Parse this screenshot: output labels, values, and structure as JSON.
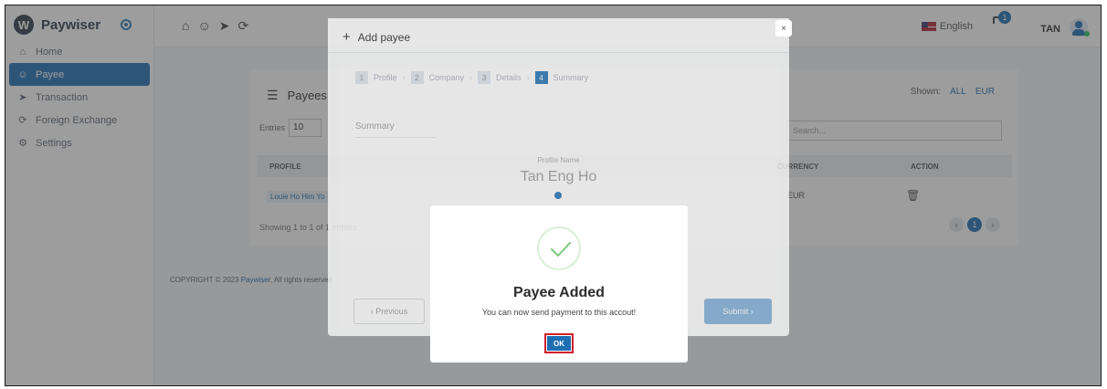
{
  "sidebar": {
    "brand": "Paywiser",
    "logo_letter": "W",
    "items": [
      {
        "label": "Home",
        "icon": "home-icon",
        "glyph": "⌂"
      },
      {
        "label": "Payee",
        "icon": "users-icon",
        "glyph": "☺"
      },
      {
        "label": "Transaction",
        "icon": "send-icon",
        "glyph": "➤"
      },
      {
        "label": "Foreign Exchange",
        "icon": "exchange-icon",
        "glyph": "⟳"
      },
      {
        "label": "Settings",
        "icon": "gear-icon",
        "glyph": "⚙"
      }
    ],
    "active_index": 1
  },
  "header": {
    "language": "English",
    "notification_count": "1",
    "user_name": "TAN"
  },
  "payees_card": {
    "title": "Payees",
    "shown_label": "Shown:",
    "shown_options": [
      "ALL",
      "EUR"
    ],
    "entries_label": "Entries",
    "entries_value": "10",
    "search_placeholder": "Search...",
    "columns": {
      "profile": "PROFILE",
      "currency": "CURRENCY",
      "action": "ACTION"
    },
    "row": {
      "profile": "Louie Ho Him Yo",
      "currency": "EUR"
    },
    "showing": "Showing 1 to 1 of 1 entries",
    "page": "1",
    "prev": "‹",
    "next": "›"
  },
  "footer": {
    "copyright_prefix": "COPYRIGHT © 2023",
    "brand": "Paywiser",
    "suffix": ", All rights reserved"
  },
  "add_payee": {
    "title": "Add payee",
    "steps": [
      {
        "num": "1",
        "label": "Profile"
      },
      {
        "num": "2",
        "label": "Company"
      },
      {
        "num": "3",
        "label": "Details"
      },
      {
        "num": "4",
        "label": "Summary"
      }
    ],
    "summary_label": "Summary",
    "profile_name_label": "Profile Name",
    "profile_name_value": "Tan Eng Ho",
    "previous_label": "‹ Previous",
    "submit_label": "Submit ›",
    "close_label": "×"
  },
  "dialog": {
    "title": "Payee Added",
    "message": "You can now send payment to this accout!",
    "ok_label": "OK"
  }
}
